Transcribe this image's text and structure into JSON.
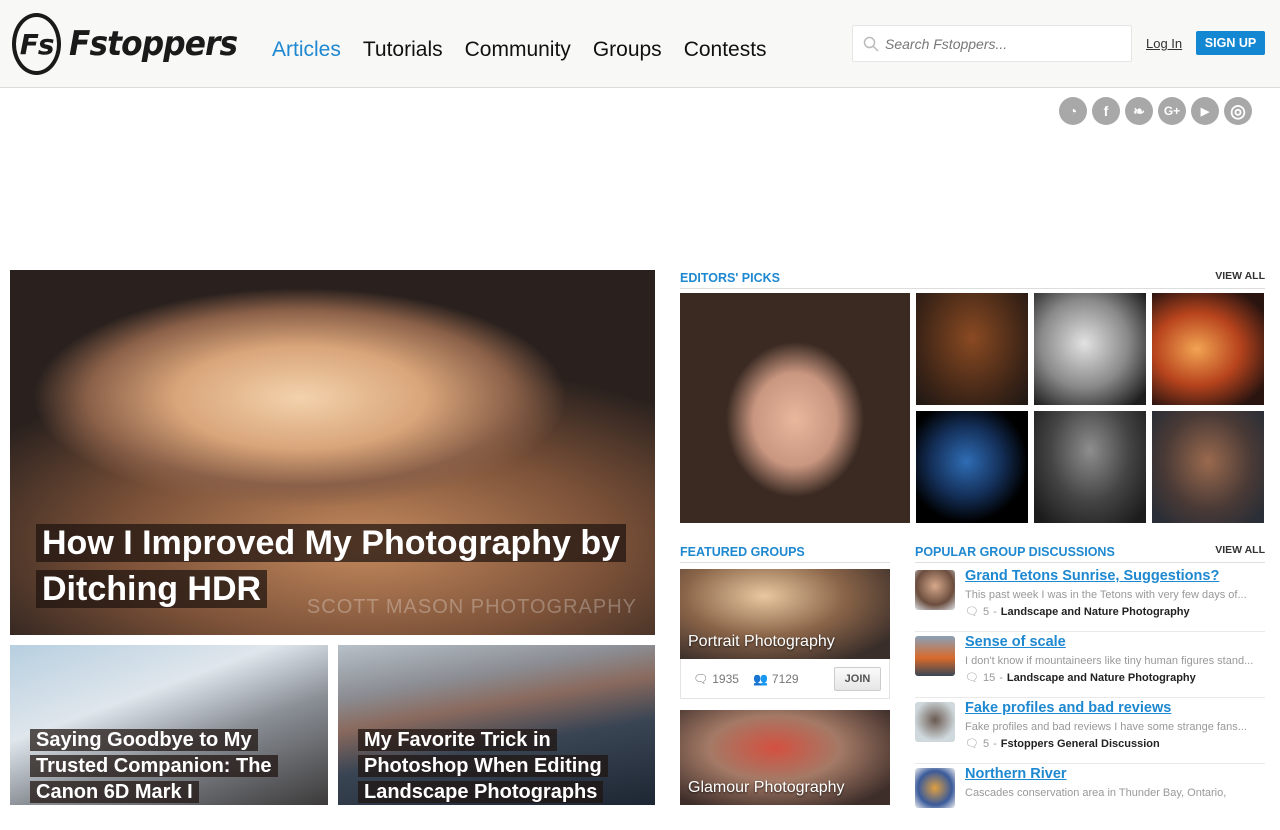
{
  "header": {
    "logo_mark": "Fs",
    "logo_text": "Fstoppers",
    "nav": [
      {
        "label": "Articles",
        "active": true
      },
      {
        "label": "Tutorials",
        "active": false
      },
      {
        "label": "Community",
        "active": false
      },
      {
        "label": "Groups",
        "active": false
      },
      {
        "label": "Contests",
        "active": false
      }
    ],
    "search_placeholder": "Search Fstoppers...",
    "login_label": "Log In",
    "signup_label": "SIGN UP"
  },
  "social_icons": [
    {
      "name": "rss-icon",
      "glyph": "◔"
    },
    {
      "name": "facebook-icon",
      "glyph": "f"
    },
    {
      "name": "twitter-icon",
      "glyph": "❧"
    },
    {
      "name": "google-plus-icon",
      "glyph": "G+"
    },
    {
      "name": "youtube-icon",
      "glyph": "▶"
    },
    {
      "name": "instagram-icon",
      "glyph": "◎"
    }
  ],
  "articles": {
    "hero": {
      "title": "How I Improved My Photography by Ditching HDR",
      "watermark": "SCOTT MASON PHOTOGRAPHY"
    },
    "cards": [
      {
        "title": "Saying Goodbye to My Trusted Companion: The Canon 6D Mark I"
      },
      {
        "title": "My Favorite Trick in Photoshop When Editing Landscape Photographs"
      }
    ]
  },
  "editors_picks": {
    "title": "EDITORS' PICKS",
    "view_all": "VIEW ALL"
  },
  "featured_groups": {
    "title": "FEATURED GROUPS",
    "groups": [
      {
        "name": "Portrait Photography",
        "discussions": "1935",
        "members": "7129",
        "join_label": "JOIN"
      },
      {
        "name": "Glamour Photography"
      }
    ]
  },
  "popular_discussions": {
    "title": "POPULAR GROUP DISCUSSIONS",
    "view_all": "VIEW ALL",
    "items": [
      {
        "title": "Grand Tetons Sunrise, Suggestions?",
        "excerpt": "This past week I was in the Tetons with very few days of...",
        "comments": "5",
        "group": "Landscape and Nature Photography"
      },
      {
        "title": "Sense of scale",
        "excerpt": "I don't know if mountaineers like tiny human figures stand...",
        "comments": "15",
        "group": "Landscape and Nature Photography"
      },
      {
        "title": "Fake profiles and bad reviews",
        "excerpt": "Fake profiles and bad reviews I have some strange fans...",
        "comments": "5",
        "group": "Fstoppers General Discussion"
      },
      {
        "title": "Northern River",
        "excerpt": "Cascades conservation area in Thunder Bay, Ontario,",
        "comments": "",
        "group": ""
      }
    ]
  }
}
